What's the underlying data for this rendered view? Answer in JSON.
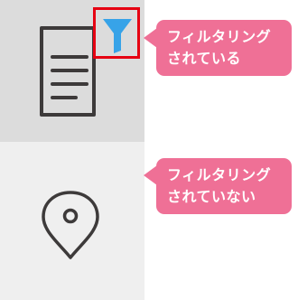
{
  "colors": {
    "filter_icon": "#37a3e8",
    "highlight_box": "#e60012",
    "callout_background": "#ef7096",
    "callout_text": "#ffffff",
    "icon_stroke": "#3d3a3a"
  },
  "sidebar": {
    "items": [
      {
        "icon": "document-icon",
        "badge_icon": "filter-icon",
        "state": "filtered",
        "callout": "フィルタリング\nされている"
      },
      {
        "icon": "map-pin-icon",
        "state": "not-filtered",
        "callout": "フィルタリング\nされていない"
      }
    ]
  }
}
